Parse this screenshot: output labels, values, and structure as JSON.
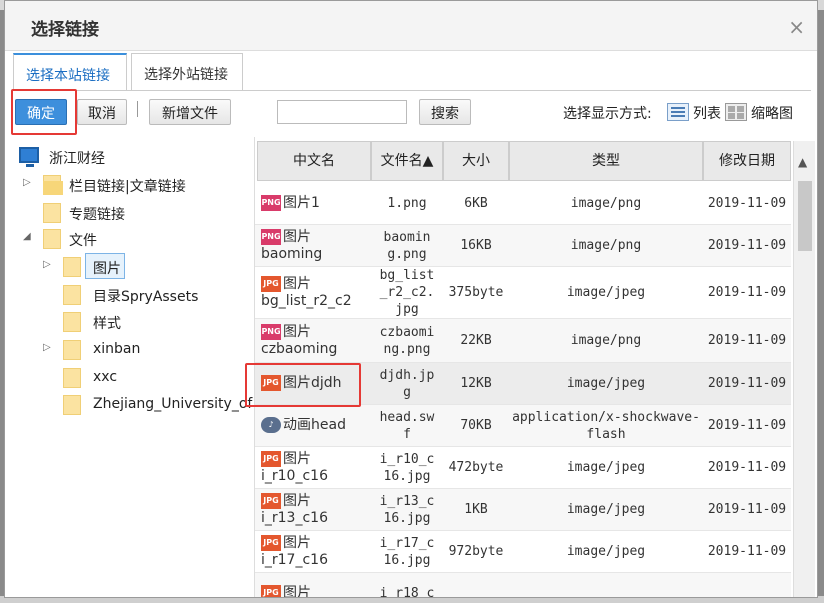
{
  "dialog": {
    "title": "选择链接",
    "close_glyph": "×"
  },
  "tabs": [
    {
      "label": "选择本站链接",
      "active": true
    },
    {
      "label": "选择外站链接",
      "active": false
    }
  ],
  "toolbar": {
    "confirm": "确定",
    "cancel": "取消",
    "new_file": "新增文件",
    "search_value": "",
    "search": "搜索",
    "view_label": "选择显示方式:",
    "list": "列表",
    "thumb": "缩略图"
  },
  "tree": {
    "root": "浙江财经",
    "items": [
      {
        "label": "栏目链接|文章链接"
      },
      {
        "label": "专题链接"
      },
      {
        "label": "文件"
      },
      {
        "label": "图片"
      },
      {
        "label": "目录SpryAssets"
      },
      {
        "label": "样式"
      },
      {
        "label": "xinban"
      },
      {
        "label": "xxc"
      },
      {
        "label": "Zhejiang_University_of"
      }
    ]
  },
  "table": {
    "headers": [
      "中文名",
      "文件名▲",
      "大小",
      "类型",
      "修改日期"
    ],
    "rows": [
      {
        "name1": "图片1",
        "name2": "",
        "file": "1.png",
        "size": "6KB",
        "type": "image/png",
        "date": "2019-11-09",
        "icon": "png-icon"
      },
      {
        "name1": "图片",
        "name2": "baoming",
        "file": "baomin\ng.png",
        "size": "16KB",
        "type": "image/png",
        "date": "2019-11-09",
        "icon": "png-icon"
      },
      {
        "name1": "图片",
        "name2": "bg_list_r2_c2",
        "file": "bg_list\n_r2_c2.\njpg",
        "size": "375byte",
        "type": "image/jpeg",
        "date": "2019-11-09",
        "icon": "jpg-icon"
      },
      {
        "name1": "图片",
        "name2": "czbaoming",
        "file": "czbaomi\nng.png",
        "size": "22KB",
        "type": "image/png",
        "date": "2019-11-09",
        "icon": "png-icon"
      },
      {
        "name1": "图片djdh",
        "name2": "",
        "file": "djdh.jp\ng",
        "size": "12KB",
        "type": "image/jpeg",
        "date": "2019-11-09",
        "icon": "jpg-icon"
      },
      {
        "name1": "动画head",
        "name2": "",
        "file": "head.sw\nf",
        "size": "70KB",
        "type": "application/x-shockwave-\nflash",
        "date": "2019-11-09",
        "icon": "swf-icon"
      },
      {
        "name1": "图片",
        "name2": "i_r10_c16",
        "file": "i_r10_c\n16.jpg",
        "size": "472byte",
        "type": "image/jpeg",
        "date": "2019-11-09",
        "icon": "jpg-icon"
      },
      {
        "name1": "图片",
        "name2": "i_r13_c16",
        "file": "i_r13_c\n16.jpg",
        "size": "1KB",
        "type": "image/jpeg",
        "date": "2019-11-09",
        "icon": "jpg-icon"
      },
      {
        "name1": "图片",
        "name2": "i_r17_c16",
        "file": "i_r17_c\n16.jpg",
        "size": "972byte",
        "type": "image/jpeg",
        "date": "2019-11-09",
        "icon": "jpg-icon"
      },
      {
        "name1": "图片",
        "name2": "",
        "file": "i r18 c",
        "size": "",
        "type": "",
        "date": "",
        "icon": "jpg-icon"
      }
    ]
  }
}
